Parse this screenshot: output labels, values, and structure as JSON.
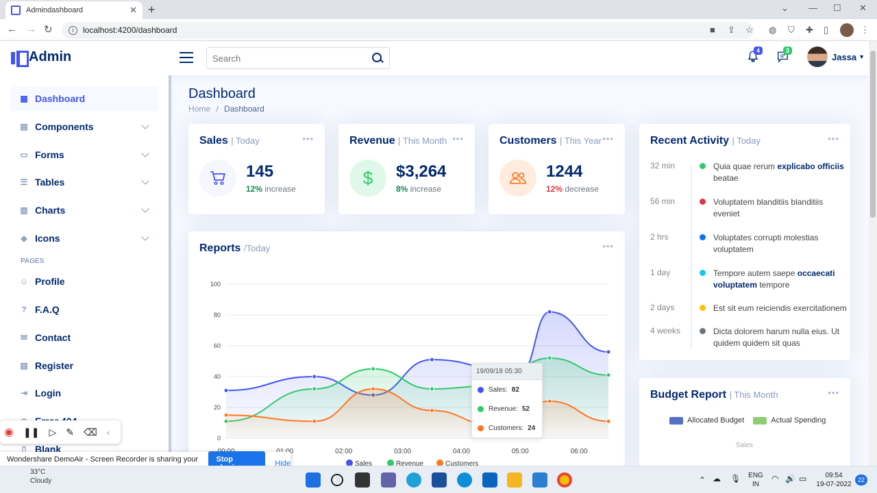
{
  "browser": {
    "tab_title": "Admindashboard",
    "url": "localhost:4200/dashboard"
  },
  "header": {
    "brand": "Admin",
    "search_placeholder": "Search",
    "notifications_count": "4",
    "messages_count": "3",
    "user_name": "Jassa"
  },
  "sidebar": {
    "items": [
      {
        "label": "Dashboard",
        "icon": "grid-icon",
        "active": true
      },
      {
        "label": "Components",
        "icon": "menu-button-icon",
        "expandable": true
      },
      {
        "label": "Forms",
        "icon": "journal-text-icon",
        "expandable": true
      },
      {
        "label": "Tables",
        "icon": "layout-text-icon",
        "expandable": true
      },
      {
        "label": "Charts",
        "icon": "bar-chart-icon",
        "expandable": true
      },
      {
        "label": "Icons",
        "icon": "gem-icon",
        "expandable": true
      }
    ],
    "pages_heading": "PAGES",
    "pages": [
      {
        "label": "Profile",
        "icon": "person-icon"
      },
      {
        "label": "F.A.Q",
        "icon": "question-circle-icon"
      },
      {
        "label": "Contact",
        "icon": "envelope-icon"
      },
      {
        "label": "Register",
        "icon": "card-list-icon"
      },
      {
        "label": "Login",
        "icon": "box-arrow-in-right-icon"
      },
      {
        "label": "Error 404",
        "icon": "dash-circle-icon"
      },
      {
        "label": "Blank",
        "icon": "file-icon"
      }
    ]
  },
  "page": {
    "title": "Dashboard",
    "breadcrumb": [
      "Home",
      "/",
      "Dashboard"
    ]
  },
  "stats": {
    "sales": {
      "title": "Sales",
      "period": "| Today",
      "value": "145",
      "pct": "12%",
      "change": "increase",
      "color": "#4154f1"
    },
    "revenue": {
      "title": "Revenue",
      "period": "| This Month",
      "value": "$3,264",
      "pct": "8%",
      "change": "increase",
      "color": "#2eca6a"
    },
    "customers": {
      "title": "Customers",
      "period": "| This Year",
      "value": "1244",
      "pct": "12%",
      "change": "decrease",
      "color": "#ff771d"
    }
  },
  "reports": {
    "title": "Reports",
    "period": "/Today",
    "tooltip": {
      "time": "19/09/18 05:30",
      "rows": [
        {
          "label": "Sales:",
          "value": "82"
        },
        {
          "label": "Revenue:",
          "value": "52"
        },
        {
          "label": "Customers:",
          "value": "24"
        }
      ]
    }
  },
  "chart_data": {
    "type": "area",
    "x": [
      "00:00",
      "01:00",
      "02:00",
      "03:00",
      "04:00",
      "05:00",
      "06:00"
    ],
    "ylim": [
      0,
      100
    ],
    "yticks": [
      "0",
      "20",
      "40",
      "60",
      "80",
      "100"
    ],
    "series": [
      {
        "name": "Sales",
        "color": "#4154f1",
        "points": [
          [
            0,
            31
          ],
          [
            1.5,
            40
          ],
          [
            2.5,
            28
          ],
          [
            3.5,
            51
          ],
          [
            5.0,
            42
          ],
          [
            5.5,
            82
          ],
          [
            6.5,
            56
          ]
        ]
      },
      {
        "name": "Revenue",
        "color": "#2eca6a",
        "points": [
          [
            0,
            11
          ],
          [
            1.5,
            32
          ],
          [
            2.5,
            45
          ],
          [
            3.5,
            32
          ],
          [
            4.5,
            34
          ],
          [
            5.5,
            52
          ],
          [
            6.5,
            41
          ]
        ]
      },
      {
        "name": "Customers",
        "color": "#ff771d",
        "points": [
          [
            0,
            15
          ],
          [
            1.5,
            11
          ],
          [
            2.5,
            32
          ],
          [
            3.5,
            18
          ],
          [
            4.5,
            9
          ],
          [
            5.5,
            24
          ],
          [
            6.5,
            11
          ]
        ]
      }
    ]
  },
  "activity": {
    "title": "Recent Activity",
    "period": "| Today",
    "items": [
      {
        "time": "32 min",
        "color": "#2eca6a",
        "pre": "Quia quae rerum ",
        "bold": "explicabo officiis",
        "post": " beatae"
      },
      {
        "time": "56 min",
        "color": "#dc3545",
        "pre": "Voluptatem blanditiis blanditiis eveniet",
        "bold": "",
        "post": ""
      },
      {
        "time": "2 hrs",
        "color": "#0d6efd",
        "pre": "Voluptates corrupti molestias voluptatem",
        "bold": "",
        "post": ""
      },
      {
        "time": "1 day",
        "color": "#0dcaf0",
        "pre": "Tempore autem saepe ",
        "bold": "occaecati voluptatem",
        "post": " tempore"
      },
      {
        "time": "2 days",
        "color": "#ffc107",
        "pre": "Est sit eum reiciendis exercitationem",
        "bold": "",
        "post": ""
      },
      {
        "time": "4 weeks",
        "color": "#6c757d",
        "pre": "Dicta dolorem harum nulla eius. Ut quidem quidem sit quas",
        "bold": "",
        "post": ""
      }
    ]
  },
  "budget": {
    "title": "Budget Report",
    "period": "| This Month",
    "legend": [
      {
        "label": "Allocated Budget",
        "color": "#5470c6"
      },
      {
        "label": "Actual Spending",
        "color": "#91cc75"
      }
    ],
    "axis_label": "Sales"
  },
  "overlay": {
    "share_text": "Wondershare DemoAir - Screen Recorder is sharing your screen.",
    "stop_label": "Stop sharing",
    "hide_label": "Hide"
  },
  "taskbar": {
    "weather_temp": "33°C",
    "weather_desc": "Cloudy",
    "lang1": "ENG",
    "lang2": "IN",
    "time": "09:54",
    "date": "19-07-2022",
    "notif": "22"
  }
}
